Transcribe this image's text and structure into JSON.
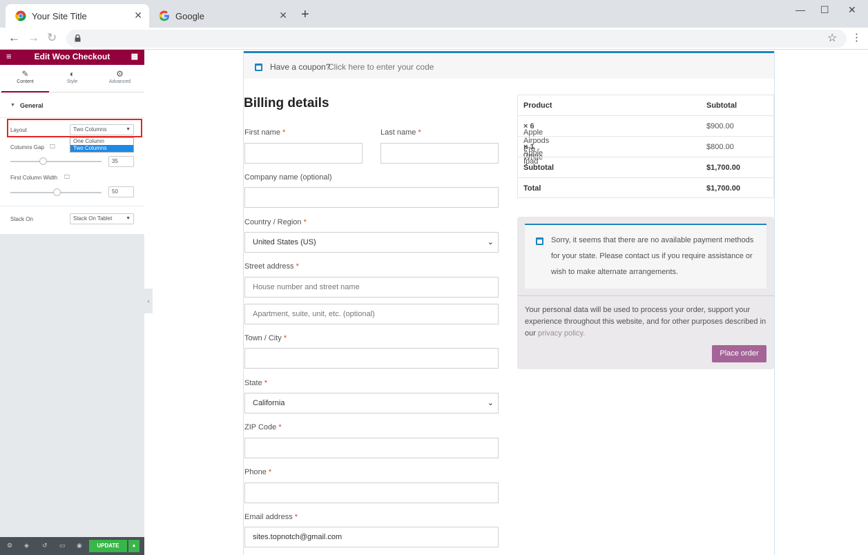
{
  "browser": {
    "tabs": [
      {
        "title": "Your Site Title",
        "active": true,
        "icon": "chrome-icon"
      },
      {
        "title": "Google",
        "active": false,
        "icon": "google-icon"
      }
    ],
    "new_tab": "+",
    "close_glyph": "✕",
    "window": {
      "minimize": "—",
      "maximize": "☐",
      "close": "✕"
    }
  },
  "panel": {
    "title": "Edit Woo Checkout",
    "tabs": [
      {
        "label": "Content",
        "icon": "pencil-icon"
      },
      {
        "label": "Style",
        "icon": "contrast-icon"
      },
      {
        "label": "Advanced",
        "icon": "gear-icon"
      }
    ],
    "section": "General",
    "layout_label": "Layout",
    "layout_value": "Two Columns",
    "layout_options": [
      "One Column",
      "Two Columns"
    ],
    "columns_gap_label": "Columns Gap",
    "columns_gap_value": "35",
    "first_col_width_label": "First Column Width",
    "first_col_width_value": "50",
    "stack_on_label": "Stack On",
    "stack_on_value": "Stack On Tablet",
    "update_label": "UPDATE"
  },
  "checkout": {
    "coupon_text": "Have a coupon?",
    "coupon_link": "Click here to enter your code",
    "billing_title": "Billing details",
    "fields": {
      "first_name": "First name",
      "last_name": "Last name",
      "company": "Company name (optional)",
      "country": "Country / Region",
      "country_value": "United States (US)",
      "street": "Street address",
      "street_ph1": "House number and street name",
      "street_ph2": "Apartment, suite, unit, etc. (optional)",
      "city": "Town / City",
      "state": "State",
      "state_value": "California",
      "zip": "ZIP Code",
      "phone": "Phone",
      "email": "Email address",
      "email_value": "sites.topnotch@gmail.com"
    },
    "required_mark": "*",
    "order": {
      "head_product": "Product",
      "head_subtotal": "Subtotal",
      "items": [
        {
          "name": "Apple Airpods Pro - White",
          "qty": "× 6",
          "price": "$900.00"
        },
        {
          "name": "Apple Ipad",
          "qty": "× 1",
          "price": "$800.00"
        }
      ],
      "subtotal_label": "Subtotal",
      "subtotal_value": "$1,700.00",
      "total_label": "Total",
      "total_value": "$1,700.00"
    },
    "payment_notice": "Sorry, it seems that there are no available payment methods for your state. Please contact us if you require assistance or wish to make alternate arrangements.",
    "privacy_text": "Your personal data will be used to process your order, support your experience throughout this website, and for other purposes described in our",
    "privacy_link": "privacy policy.",
    "place_order": "Place order"
  }
}
